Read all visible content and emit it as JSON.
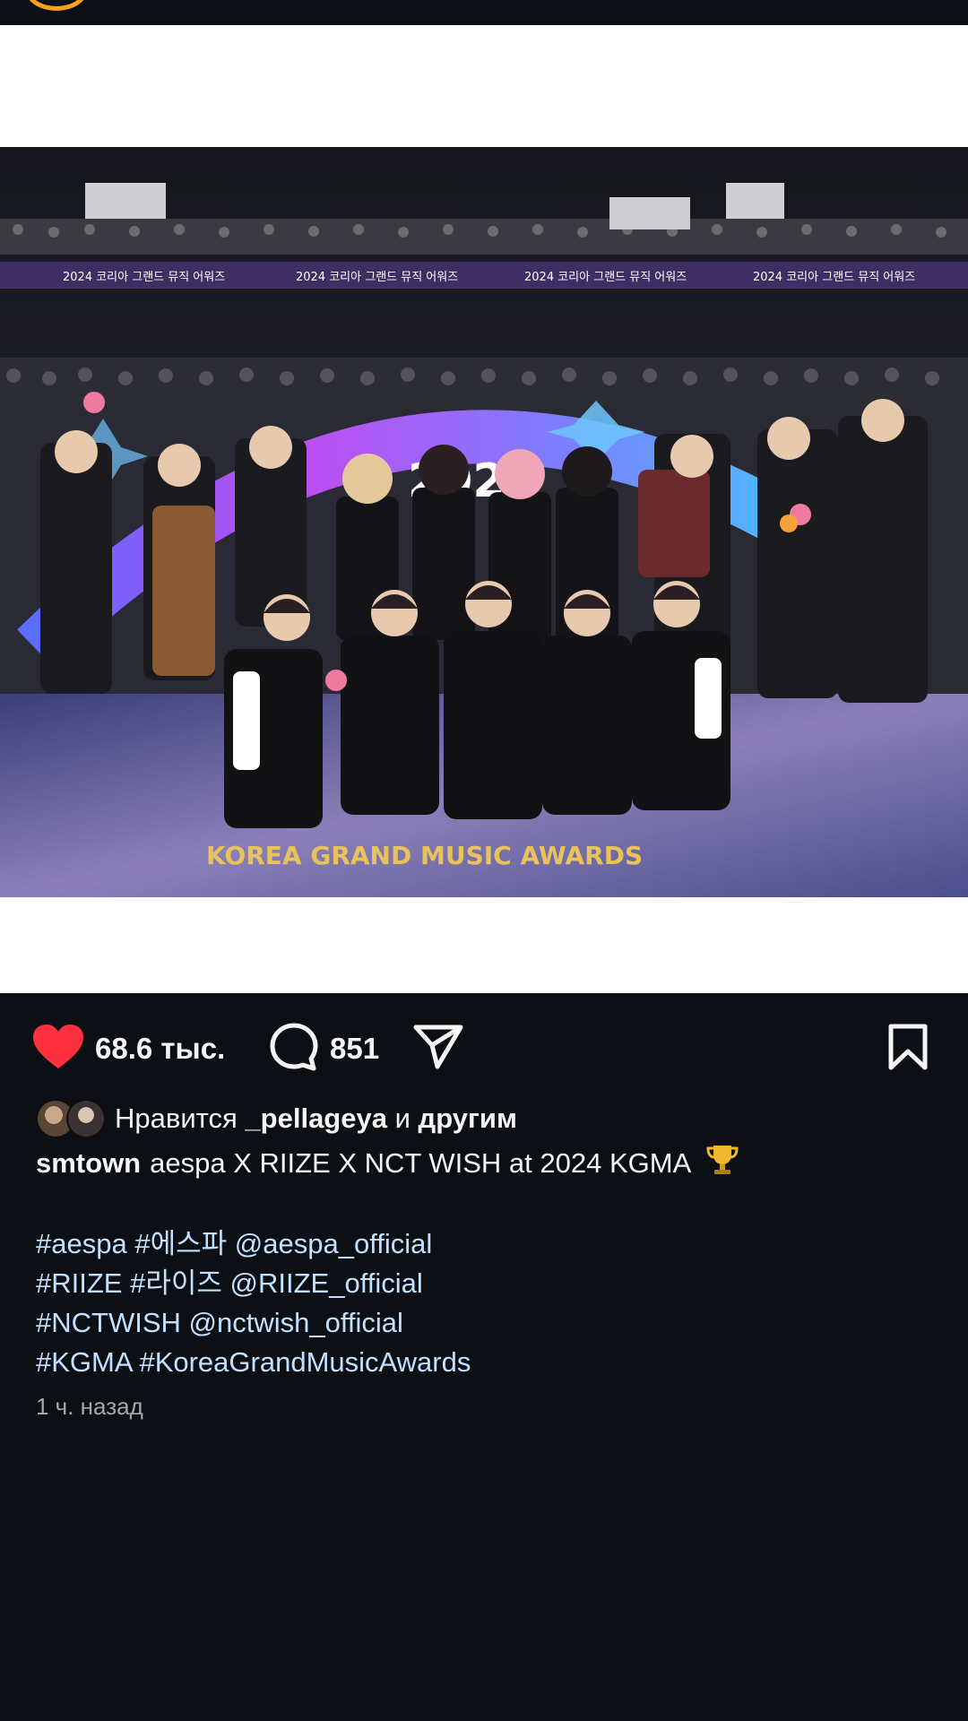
{
  "post": {
    "likes_count": "68.6 тыс.",
    "comments_count": "851",
    "liked_by_prefix": "Нравится",
    "liked_by_user": "_pellageya",
    "liked_by_and": "и",
    "liked_by_others": "другим",
    "username": "smtown",
    "caption_text": "aespa X RIIZE X NCT WISH at 2024 KGMA",
    "caption_emoji": "trophy-icon",
    "hashtag_lines": [
      [
        "#aespa",
        "#에스파",
        "@aespa_official"
      ],
      [
        "#RIIZE",
        "#라이즈",
        "@RIIZE_official"
      ],
      [
        "#NCTWISH",
        "@nctwish_official"
      ],
      [
        "#KGMA",
        "#KoreaGrandMusicAwards"
      ]
    ],
    "timestamp": "1 ч. назад",
    "photo_banner_text": "2024 코리아 그랜드 뮤직 어워즈",
    "photo_stage_text": "202",
    "photo_floor_text": "KOREA GRAND MUSIC AWARDS"
  },
  "colors": {
    "background": "#0c1014",
    "like_red": "#ff3040",
    "link_blue": "#c2e0ff"
  }
}
